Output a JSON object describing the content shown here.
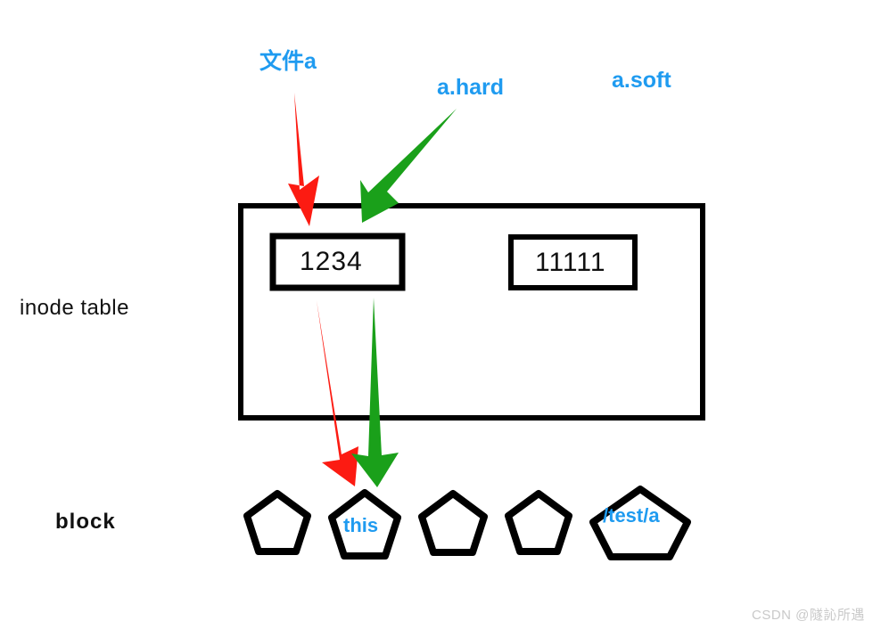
{
  "diagram": {
    "title": "inode table and block linkage diagram",
    "colors": {
      "annotation_blue": "#1f9bf0",
      "hard_link_arrow": "#1aa01a",
      "file_arrow": "#fc1b12",
      "outline_black": "#000000",
      "watermark_gray": "#c9c9c9"
    },
    "row_labels": [
      {
        "id": "inode-table",
        "text": "inode  table"
      },
      {
        "id": "block",
        "text": "block"
      }
    ],
    "annotations": [
      {
        "id": "file-a",
        "text": "文件a",
        "color": "#1f9bf0"
      },
      {
        "id": "a-hard",
        "text": "a.hard",
        "color": "#1f9bf0"
      },
      {
        "id": "a-soft",
        "text": "a.soft",
        "color": "#1f9bf0"
      }
    ],
    "inode_entries": [
      {
        "id": "inode-1234",
        "value": "1234"
      },
      {
        "id": "inode-11111",
        "value": "11111"
      }
    ],
    "blocks": [
      {
        "id": "block-1",
        "label": ""
      },
      {
        "id": "block-2",
        "label": "this"
      },
      {
        "id": "block-3",
        "label": ""
      },
      {
        "id": "block-4",
        "label": ""
      },
      {
        "id": "block-5",
        "label": "/test/a"
      }
    ],
    "arrows": [
      {
        "id": "arrow-file-a-to-inode",
        "color": "#fc1b12",
        "from": "文件a",
        "to": "1234"
      },
      {
        "id": "arrow-a-hard-to-inode",
        "color": "#1aa01a",
        "from": "a.hard",
        "to": "1234"
      },
      {
        "id": "arrow-inode-to-block-red",
        "color": "#fc1b12",
        "from": "1234",
        "to": "this"
      },
      {
        "id": "arrow-inode-to-block-green",
        "color": "#1aa01a",
        "from": "1234",
        "to": "this"
      }
    ],
    "watermark": "CSDN @隧訫所遇"
  }
}
